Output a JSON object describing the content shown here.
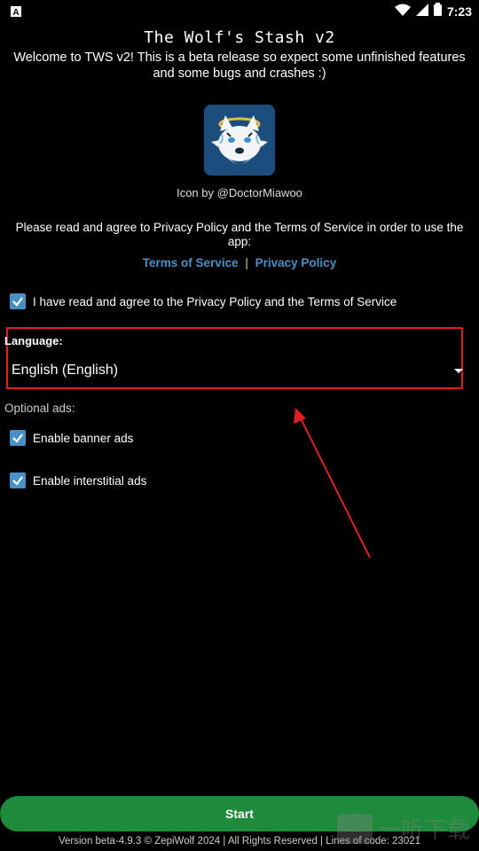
{
  "statusbar": {
    "time": "7:23",
    "icons": [
      "a-icon",
      "wifi-icon",
      "signal-icon",
      "battery-icon"
    ]
  },
  "header": {
    "title": "The Wolf's Stash v2",
    "welcome": "Welcome to TWS v2! This is a beta release so expect some unfinished features and some bugs and crashes :)"
  },
  "icon_credit": "Icon by @DoctorMiawoo",
  "agreement": {
    "text": "Please read and agree to Privacy Policy and the Terms of Service in order to use the app:",
    "tos_link": "Terms of Service",
    "separator": "|",
    "privacy_link": "Privacy Policy",
    "checkbox_label": "I have read and agree to the Privacy Policy and the Terms of Service",
    "checked": true
  },
  "language": {
    "label": "Language:",
    "selected": "English (English)"
  },
  "optional_ads": {
    "label": "Optional ads:",
    "banner_label": "Enable banner ads",
    "banner_checked": true,
    "interstitial_label": "Enable interstitial ads",
    "interstitial_checked": true
  },
  "start_button": "Start",
  "footer": "Version beta-4.9.3 © ZepiWolf 2024 | All Rights Reserved | Lines of code: 23021",
  "watermark": {
    "text": "一听下载"
  },
  "colors": {
    "accent": "#4a90c8",
    "start_green": "#1d8a3c",
    "annotation_red": "#e02020"
  }
}
